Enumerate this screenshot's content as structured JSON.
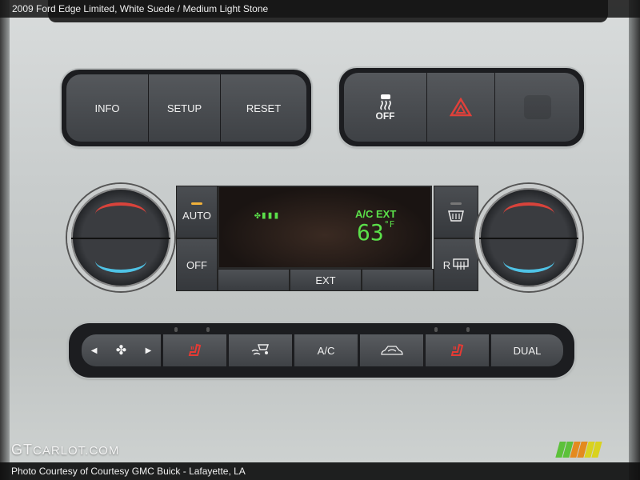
{
  "title": "2009 Ford Edge Limited,   White Suede / Medium Light Stone",
  "top_buttons": {
    "info": "INFO",
    "setup": "SETUP",
    "reset": "RESET",
    "traction_off": "OFF",
    "traction_icon": "traction-control-icon",
    "hazard_icon": "hazard-warning-icon",
    "airbag_indicator_icon": "passenger-airbag-off-icon"
  },
  "climate": {
    "auto_label": "AUTO",
    "off_label": "OFF",
    "ext_label": "EXT",
    "display": {
      "mode": "A/C EXT",
      "temperature": "63",
      "unit": "°F",
      "fan_icon": "fan-speed-icon"
    },
    "front_defrost_icon": "front-defrost-icon",
    "rear_defrost_label": "R",
    "rear_defrost_icon": "rear-defrost-icon",
    "colors": {
      "hot": "#d8433b",
      "cold": "#4fc3e6",
      "lcd": "#5be04a",
      "led_on": "#f1b13a"
    }
  },
  "bottom_buttons": {
    "fan_left": "◀",
    "fan_right": "▶",
    "fan_icon": "fan-icon",
    "driver_seat_heat_icon": "heated-seat-icon",
    "max_defrost_icon": "defrost-airflow-icon",
    "ac": "A/C",
    "recirc_icon": "recirculation-icon",
    "passenger_seat_heat_icon": "heated-seat-icon",
    "dual": "DUAL"
  },
  "watermark": {
    "logo_main": "GT",
    "logo_rest": "CARLOT.COM"
  },
  "footer": "Photo Courtesy of Courtesy GMC Buick - Lafayette, LA"
}
